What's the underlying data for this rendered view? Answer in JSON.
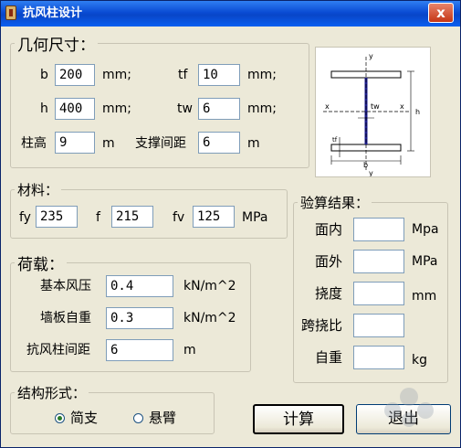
{
  "window": {
    "title": "抗风柱设计",
    "close_label": "x"
  },
  "geometry": {
    "legend": "几何尺寸：",
    "b_label": "b",
    "b_value": "200",
    "b_unit": "mm;",
    "h_label": "h",
    "h_value": "400",
    "h_unit": "mm;",
    "tf_label": "tf",
    "tf_value": "10",
    "tf_unit": "mm;",
    "tw_label": "tw",
    "tw_value": "6",
    "tw_unit": "mm;",
    "height_label": "柱高",
    "height_value": "9",
    "height_unit": "m",
    "brace_label": "支撑间距",
    "brace_value": "6",
    "brace_unit": "m"
  },
  "diagram": {
    "y_top": "y",
    "y_bottom": "y",
    "x_left": "x",
    "x_right": "x",
    "tw": "tw",
    "b": "b",
    "h": "h",
    "tf": "tf"
  },
  "material": {
    "legend": "材料：",
    "fy_label": "fy",
    "fy_value": "235",
    "f_label": "f",
    "f_value": "215",
    "fv_label": "fv",
    "fv_value": "125",
    "unit": "MPa"
  },
  "load": {
    "legend": "荷载：",
    "wind_label": "基本风压",
    "wind_value": "0.4",
    "wind_unit": "kN/m^2",
    "wall_label": "墙板自重",
    "wall_value": "0.3",
    "wall_unit": "kN/m^2",
    "spacing_label": "抗风柱间距",
    "spacing_value": "6",
    "spacing_unit": "m"
  },
  "structure": {
    "legend": "结构形式：",
    "simple_label": "简支",
    "cantilever_label": "悬臂",
    "selected": "简支"
  },
  "results": {
    "legend": "验算结果：",
    "in_plane_label": "面内",
    "in_plane_unit": "Mpa",
    "out_plane_label": "面外",
    "out_plane_unit": "MPa",
    "deflection_label": "挠度",
    "deflection_unit": "mm",
    "span_ratio_label": "跨挠比",
    "self_weight_label": "自重",
    "self_weight_unit": "kg"
  },
  "buttons": {
    "calculate": "计算",
    "exit": "退出"
  },
  "colors": {
    "titlebar": "#0a4bd3",
    "face": "#ece9d8",
    "web_line": "#1a1a8c",
    "radio_dot": "#2a7a2a"
  }
}
